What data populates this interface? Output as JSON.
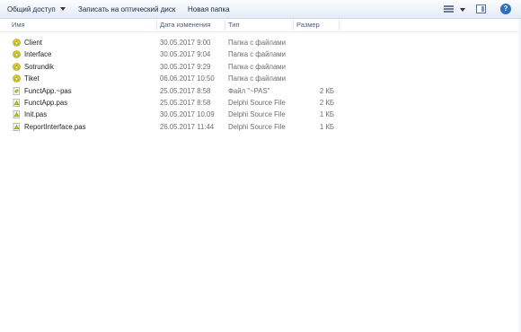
{
  "toolbar": {
    "share_label": "Общий доступ",
    "burn_label": "Записать на оптический диск",
    "new_folder_label": "Новая папка",
    "views_icon": "view-options-icon",
    "preview_icon": "preview-pane-icon",
    "help_icon": "help-icon"
  },
  "columns": {
    "name": "Имя",
    "date": "Дата изменения",
    "type": "Тип",
    "size": "Размер"
  },
  "colors": {
    "icon_green": "#7fb51c",
    "icon_yellow": "#f0c419",
    "text": "#1e1e1e",
    "secondary_text": "#6d6d6d",
    "header_text": "#4c607a"
  },
  "files": [
    {
      "name": "Client",
      "date": "30.05.2017 9:00",
      "type": "Папка с файлами",
      "size": "",
      "icon": "delphi-folder-icon"
    },
    {
      "name": "Interface",
      "date": "30.05.2017 9:04",
      "type": "Папка с файлами",
      "size": "",
      "icon": "delphi-folder-icon"
    },
    {
      "name": "Sotrundik",
      "date": "30.05.2017 9:29",
      "type": "Папка с файлами",
      "size": "",
      "icon": "delphi-folder-icon"
    },
    {
      "name": "Tiket",
      "date": "06.06.2017 10:50",
      "type": "Папка с файлами",
      "size": "",
      "icon": "delphi-folder-icon"
    },
    {
      "name": "FunctApp.~pas",
      "date": "25.05.2017 8:58",
      "type": "Файл \"~PAS\"",
      "size": "2 КБ",
      "icon": "tilde-pas-file-icon"
    },
    {
      "name": "FunctApp.pas",
      "date": "25.05.2017 8:58",
      "type": "Delphi Source File",
      "size": "2 КБ",
      "icon": "delphi-source-file-icon"
    },
    {
      "name": "Init.pas",
      "date": "30.05.2017 10:09",
      "type": "Delphi Source File",
      "size": "1 КБ",
      "icon": "delphi-source-file-icon"
    },
    {
      "name": "ReportInterface.pas",
      "date": "26.05.2017 11:44",
      "type": "Delphi Source File",
      "size": "1 КБ",
      "icon": "delphi-source-file-icon"
    }
  ]
}
